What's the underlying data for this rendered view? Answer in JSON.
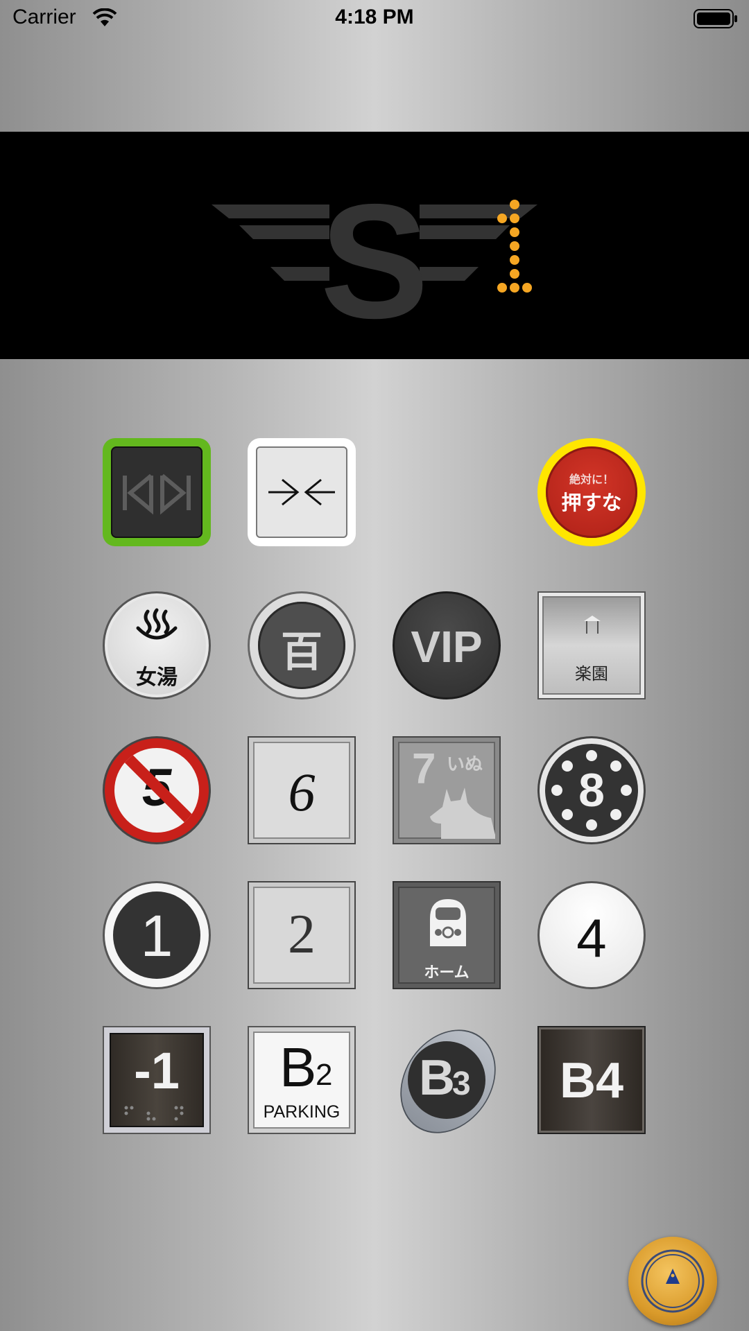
{
  "status_bar": {
    "carrier": "Carrier",
    "time": "4:18 PM"
  },
  "display": {
    "floor": "1",
    "logo_letter": "S"
  },
  "buttons": {
    "dont_press_top": "絶対に！",
    "dont_press_main": "押すな",
    "bath_label": "女湯",
    "hyaku": "百",
    "vip": "VIP",
    "rakuen": "楽園",
    "five": "5",
    "six": "6",
    "seven": "7",
    "seven_sub": "いぬ",
    "eight": "8",
    "one": "1",
    "two": "2",
    "home_label": "ホーム",
    "four": "4",
    "minus_one": "-1",
    "b2_main": "B",
    "b2_sub": "2",
    "b2_parking": "PARKING",
    "b3_main": "B",
    "b3_sub": "3",
    "b4": "B4"
  },
  "colors": {
    "indicator": "#f5a623",
    "open_frame": "#63b81e",
    "dont_press_ring": "#ffe600",
    "dont_press_fill": "#c0281c",
    "no_sign_red": "#c8201a"
  }
}
